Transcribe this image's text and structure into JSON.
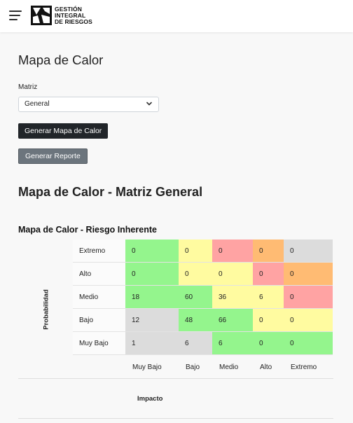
{
  "brand": {
    "line1": "GESTIÓN",
    "line2": "INTEGRAL",
    "line3": "DE RIESGOS"
  },
  "page": {
    "title": "Mapa de Calor",
    "matrix_label": "Matriz",
    "matrix_value": "General",
    "generate_map_button": "Generar Mapa de Calor",
    "generate_report_button": "Generar Reporte",
    "section_title": "Mapa de Calor - Matriz General",
    "subtitle": "Mapa de Calor - Riesgo Inherente"
  },
  "colors": {
    "green": "#94f58d",
    "yellow": "#fffba0",
    "red": "#ffa3a3",
    "orange": "#ffbb73",
    "gray": "#dcdcdc",
    "dark_button": "#212529",
    "gray_button": "#6c757d"
  },
  "chart_data": {
    "type": "heatmap",
    "title": "Mapa de Calor - Riesgo Inherente",
    "ylabel": "Probabilidad",
    "xlabel": "Impacto",
    "columns": [
      "Muy Bajo",
      "Bajo",
      "Medio",
      "Alto",
      "Extremo"
    ],
    "rows": [
      {
        "label": "Extremo",
        "values": [
          "0",
          "0",
          "0",
          "0",
          "0"
        ],
        "colors": [
          "green",
          "yellow",
          "red",
          "orange",
          "gray"
        ]
      },
      {
        "label": "Alto",
        "values": [
          "0",
          "0",
          "0",
          "0",
          "0"
        ],
        "colors": [
          "green",
          "yellow",
          "yellow",
          "red",
          "orange"
        ]
      },
      {
        "label": "Medio",
        "values": [
          "18",
          "60",
          "36",
          "6",
          "0"
        ],
        "colors": [
          "green",
          "green",
          "yellow",
          "yellow",
          "red"
        ]
      },
      {
        "label": "Bajo",
        "values": [
          "12",
          "48",
          "66",
          "0",
          "0"
        ],
        "colors": [
          "gray",
          "green",
          "green",
          "yellow",
          "yellow"
        ]
      },
      {
        "label": "Muy Bajo",
        "values": [
          "1",
          "6",
          "6",
          "0",
          "0"
        ],
        "colors": [
          "gray",
          "gray",
          "green",
          "green",
          "green"
        ]
      }
    ]
  }
}
